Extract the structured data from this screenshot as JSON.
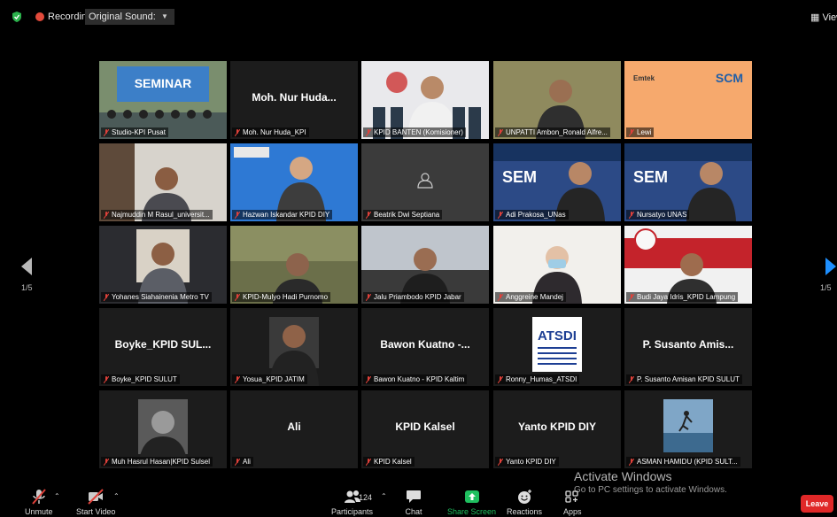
{
  "topbar": {
    "recording_label": "Recording",
    "sound_label": "Original Sound: Off",
    "view_label": "View"
  },
  "pagination": {
    "left": "1/5",
    "right": "1/5"
  },
  "tiles": [
    {
      "name": "Studio-KPI Pusat",
      "center": "",
      "scene": "stage",
      "scene_text": "SEMINAR",
      "active": true
    },
    {
      "name": "Moh. Nur Huda_KPI",
      "center": "Moh. Nur Huda...",
      "scene": "none"
    },
    {
      "name": "KPID BANTEN (Komisioner)",
      "center": "",
      "scene": "office_white"
    },
    {
      "name": "UNPATTI Ambon_Ronald Alfre...",
      "center": "",
      "scene": "person_olive"
    },
    {
      "name": "Lewi",
      "center": "",
      "scene": "slide_orange",
      "scene_text": "SCM",
      "scene_text2": "Emtek"
    },
    {
      "name": "Najmuddin M Rasul_universit...",
      "center": "",
      "scene": "person_grey"
    },
    {
      "name": "Hazwan Iskandar KPID DIY",
      "center": "",
      "scene": "person_blue"
    },
    {
      "name": "Beatrik Dwi Septiana",
      "center": "",
      "scene": "avatar_grey"
    },
    {
      "name": "Adi Prakosa_UNas",
      "center": "",
      "scene": "banner_person",
      "scene_text": "SEM"
    },
    {
      "name": "Nursatyo UNAS",
      "center": "",
      "scene": "banner_person",
      "scene_text": "SEM"
    },
    {
      "name": "Yohanes Siahainenia Metro TV",
      "center": "",
      "scene": "person_dark"
    },
    {
      "name": "KPID-Mulyo Hadi Purnomo",
      "center": "",
      "scene": "person_forest"
    },
    {
      "name": "Jalu Priambodo KPID Jabar",
      "center": "",
      "scene": "person_room"
    },
    {
      "name": "Anggreine Mandej",
      "center": "",
      "scene": "person_light"
    },
    {
      "name": "Budi Jaya Idris_KPID Lampung",
      "center": "",
      "scene": "banner_red"
    },
    {
      "name": "Boyke_KPID SULUT",
      "center": "Boyke_KPID SUL...",
      "scene": "none"
    },
    {
      "name": "Yosua_KPID JATIM",
      "center": "",
      "scene": "portrait"
    },
    {
      "name": "Bawon Kuatno - KPID Kaltim",
      "center": "Bawon Kuatno -...",
      "scene": "none"
    },
    {
      "name": "Ronny_Humas_ATSDI",
      "center": "",
      "scene": "logo",
      "scene_text": "ATSDI"
    },
    {
      "name": "P. Susanto Amisan KPID SULUT",
      "center": "P. Susanto Amis...",
      "scene": "none"
    },
    {
      "name": "Muh Hasrul Hasan|KPID Sulsel",
      "center": "",
      "scene": "portrait_bw"
    },
    {
      "name": "Ali",
      "center": "Ali",
      "scene": "none"
    },
    {
      "name": "KPID Kalsel",
      "center": "KPID Kalsel",
      "scene": "none"
    },
    {
      "name": "Yanto KPID DIY",
      "center": "Yanto KPID DIY",
      "scene": "none"
    },
    {
      "name": "ASMAN HAMIDU (KPID SULT...",
      "center": "",
      "scene": "beach"
    }
  ],
  "watermark": {
    "title": "Activate Windows",
    "subtitle": "Go to PC settings to activate Windows."
  },
  "toolbar": {
    "unmute": "Unmute",
    "start_video": "Start Video",
    "participants": "Participants",
    "participants_count": "124",
    "chat": "Chat",
    "share_screen": "Share Screen",
    "reactions": "Reactions",
    "apps": "Apps",
    "leave": "Leave"
  },
  "colors": {
    "active_border": "#c9ee4a",
    "share_green": "#1fbf5f",
    "leave_red": "#e02828",
    "muted_red": "#e0413a"
  }
}
